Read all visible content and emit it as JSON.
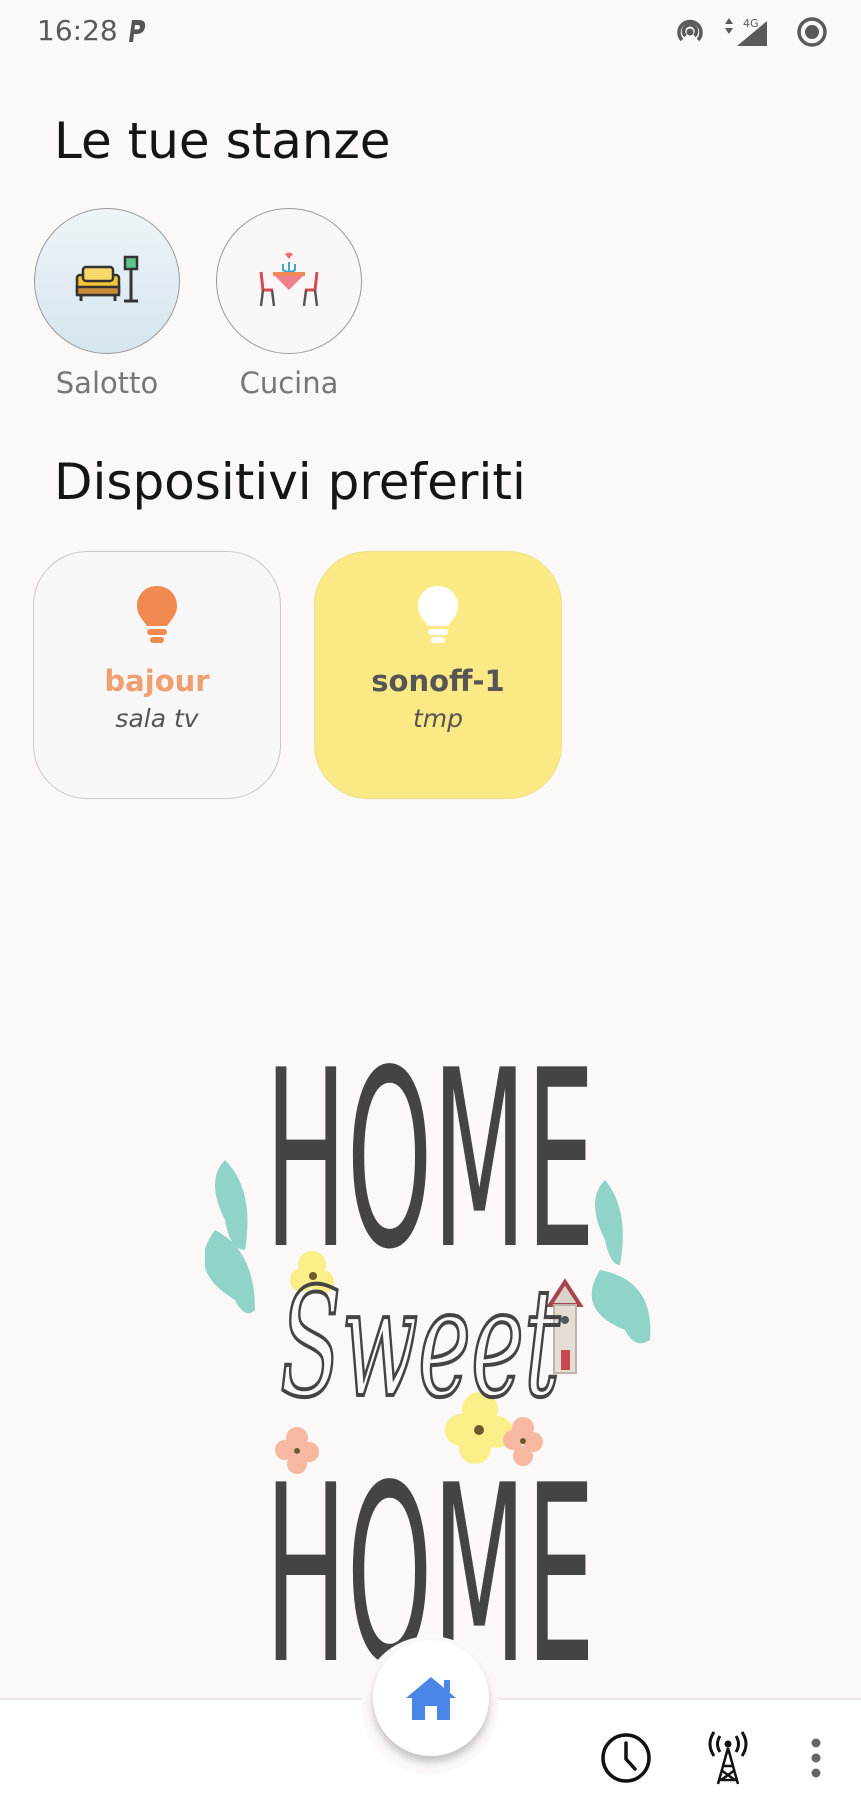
{
  "status_bar": {
    "time": "16:28",
    "icons": [
      "parking-icon",
      "hotspot-icon",
      "data-arrows-icon",
      "signal-4g-icon",
      "record-icon"
    ],
    "network_label": "4G"
  },
  "rooms": {
    "title": "Le tue stanze",
    "items": [
      {
        "label": "Salotto",
        "icon": "living-room-icon",
        "selected": true
      },
      {
        "label": "Cucina",
        "icon": "dining-room-icon",
        "selected": false
      }
    ]
  },
  "favorites": {
    "title": "Dispositivi preferiti",
    "items": [
      {
        "name": "bajour",
        "room": "sala tv",
        "icon": "lightbulb-icon",
        "state": "off",
        "color": "#f0a070",
        "icon_color": "#f08a50"
      },
      {
        "name": "sonoff-1",
        "room": "tmp",
        "icon": "lightbulb-icon",
        "state": "on",
        "color": "#555555",
        "icon_color": "#ffffff"
      }
    ]
  },
  "illustration": {
    "lines": [
      "HOME",
      "Sweet",
      "HOME"
    ]
  },
  "nav": {
    "home_icon": "home-icon",
    "items": [
      "clock-icon",
      "antenna-icon",
      "more-vert-icon"
    ],
    "accent": "#4a85e8"
  }
}
